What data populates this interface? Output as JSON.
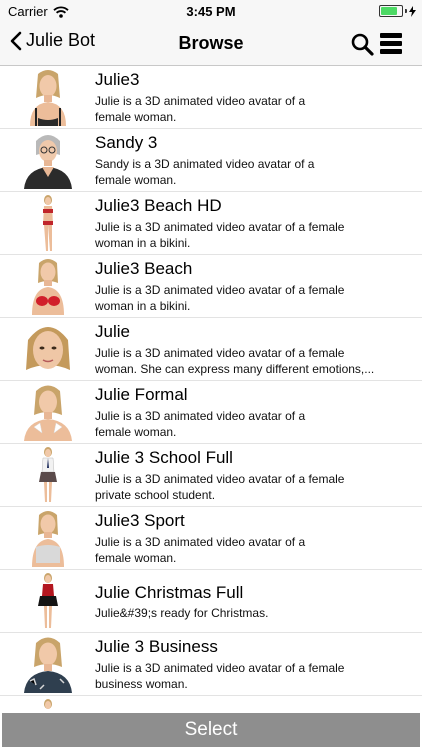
{
  "status": {
    "carrier": "Carrier",
    "time": "3:45 PM",
    "battery_level": 0.9
  },
  "nav": {
    "back_label": "Julie Bot",
    "title": "Browse"
  },
  "avatars": [
    {
      "title": "Julie3",
      "description": "Julie is a 3D animated video avatar of a\nfemale woman."
    },
    {
      "title": "Sandy 3",
      "description": "Sandy is a 3D animated video avatar of a\nfemale woman."
    },
    {
      "title": "Julie3 Beach HD",
      "description": "Julie is a 3D animated video avatar of a female\nwoman in a bikini."
    },
    {
      "title": "Julie3 Beach",
      "description": "Julie is a 3D animated video avatar of a female\nwoman in a bikini."
    },
    {
      "title": "Julie",
      "description": "Julie is a 3D animated video avatar of a female\nwoman.  She can express many different emotions,..."
    },
    {
      "title": "Julie Formal",
      "description": "Julie is a 3D animated video avatar of a\nfemale woman."
    },
    {
      "title": "Julie 3 School Full",
      "description": "Julie is a 3D animated video avatar of a female\nprivate school student."
    },
    {
      "title": "Julie3 Sport",
      "description": "Julie is a 3D animated video avatar of a\nfemale woman."
    },
    {
      "title": "Julie Christmas Full",
      "description": "Julie&#39;s ready for Christmas."
    },
    {
      "title": "Julie 3 Business",
      "description": "Julie is a 3D animated video avatar of a female\nbusiness woman."
    }
  ],
  "select_label": "Select"
}
